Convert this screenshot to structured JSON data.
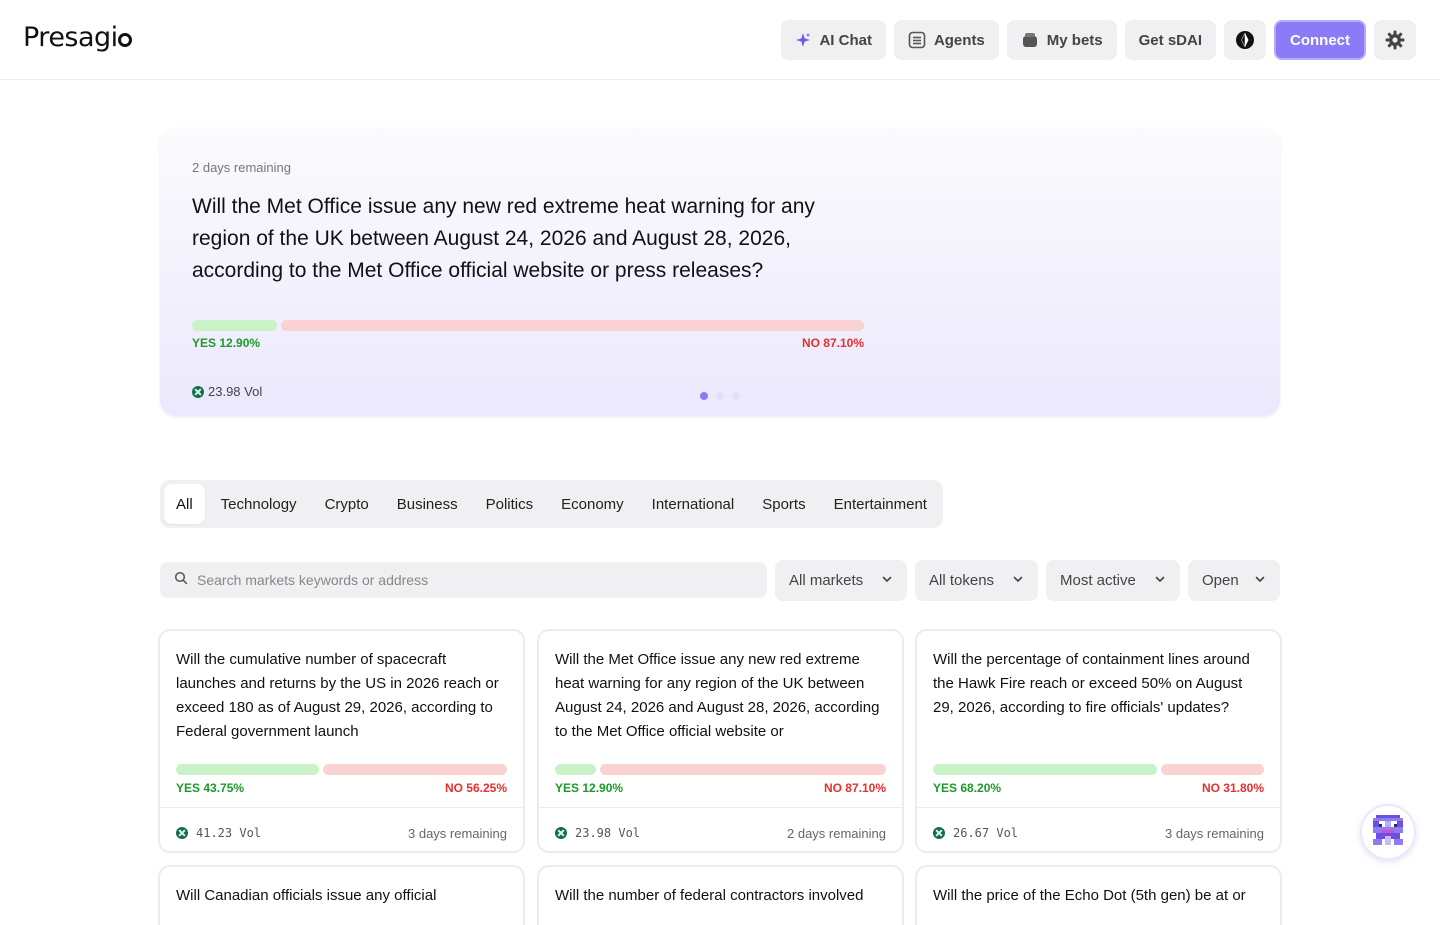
{
  "header": {
    "logo_text": "Presagi",
    "nav": {
      "ai_chat": "AI Chat",
      "agents": "Agents",
      "my_bets": "My bets",
      "get_sdai": "Get sDAI",
      "connect": "Connect"
    },
    "icons": [
      "sparkle-icon",
      "list-icon",
      "wallet-icon",
      "theme-toggle-icon",
      "gear-icon"
    ]
  },
  "hero": {
    "remaining": "2 days remaining",
    "title": "Will the Met Office issue any new red extreme heat warning for any region of the UK between August 24, 2026 and August 28, 2026, according to the Met Office official website or press releases?",
    "yes_pct": 12.9,
    "yes_label": "YES 12.90%",
    "no_label": "NO 87.10%",
    "volume": "23.98 Vol",
    "carousel_active": 0,
    "carousel_count": 3
  },
  "tabs": [
    "All",
    "Technology",
    "Crypto",
    "Business",
    "Politics",
    "Economy",
    "International",
    "Sports",
    "Entertainment"
  ],
  "active_tab": "All",
  "search": {
    "placeholder": "Search markets keywords or address"
  },
  "filters": {
    "markets": "All markets",
    "tokens": "All tokens",
    "sort": "Most active",
    "status": "Open"
  },
  "markets": [
    {
      "title": "Will the cumulative number of spacecraft launches and returns by the US in 2026 reach or exceed 180 as of August 29, 2026, according to Federal government launch",
      "yes_pct": 43.75,
      "yes_label": "YES 43.75%",
      "no_label": "NO 56.25%",
      "volume": "41.23 Vol",
      "remaining": "3 days remaining"
    },
    {
      "title": "Will the Met Office issue any new red extreme heat warning for any region of the UK between August 24, 2026 and August 28, 2026, according to the Met Office official website or",
      "yes_pct": 12.9,
      "yes_label": "YES 12.90%",
      "no_label": "NO 87.10%",
      "volume": "23.98 Vol",
      "remaining": "2 days remaining"
    },
    {
      "title": "Will the percentage of containment lines around the Hawk Fire reach or exceed 50% on August 29, 2026, according to fire officials' updates?",
      "yes_pct": 68.2,
      "yes_label": "YES 68.20%",
      "no_label": "NO 31.80%",
      "volume": "26.67 Vol",
      "remaining": "3 days remaining"
    },
    {
      "title": "Will Canadian officials issue any official"
    },
    {
      "title": "Will the number of federal contractors involved"
    },
    {
      "title": "Will the price of the Echo Dot (5th gen) be at or"
    }
  ]
}
